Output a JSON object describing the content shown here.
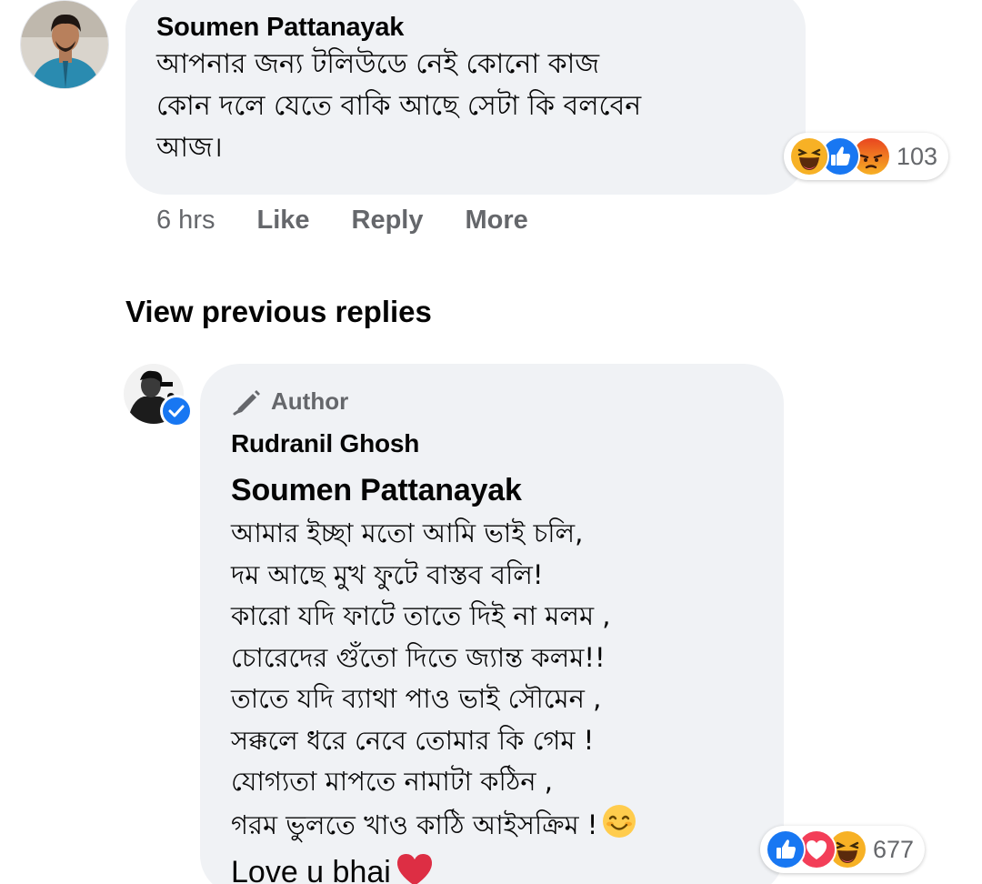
{
  "comment": {
    "author": "Soumen Pattanayak",
    "text": "আপনার জন্য টলিউডে নেই কোনো কাজ\nকোন দলে যেতে বাকি আছে সেটা কি বলবেন\nআজ।",
    "reactions": [
      "haha-icon",
      "like-icon",
      "angry-icon"
    ],
    "reaction_count": "103",
    "time": "6 hrs",
    "actions": {
      "like": "Like",
      "reply": "Reply",
      "more": "More"
    }
  },
  "view_previous": "View previous replies",
  "reply": {
    "badge": "Author",
    "author": "Rudranil Ghosh",
    "mention": "Soumen Pattanayak",
    "text": "আমার ইচ্ছা মতো আমি ভাই চলি,\nদম আছে মুখ ফুটে বাস্তব বলি!\nকারো যদি ফাটে তাতে দিই না মলম ,\nচোরেদের গুঁতো দিতে জ্যান্ত কলম!!\nতাতে যদি ব্যাথা পাও ভাই সৌমেন ,\nসক্কলে ধরে নেবে তোমার কি গেম !\nযোগ্যতা মাপতে নামাটা কঠিন ,\nগরম ভুলতে খাও কাঠি আইসক্রিম !",
    "last_line": "Love u bhai",
    "reactions": [
      "like-icon",
      "love-icon",
      "haha-icon"
    ],
    "reaction_count": "677"
  },
  "colors": {
    "bubble": "#f0f2f5",
    "secondary_text": "#65676b",
    "facebook_blue": "#1877f2",
    "love_red": "#f33e58",
    "haha_yellow": "#f7b125"
  }
}
